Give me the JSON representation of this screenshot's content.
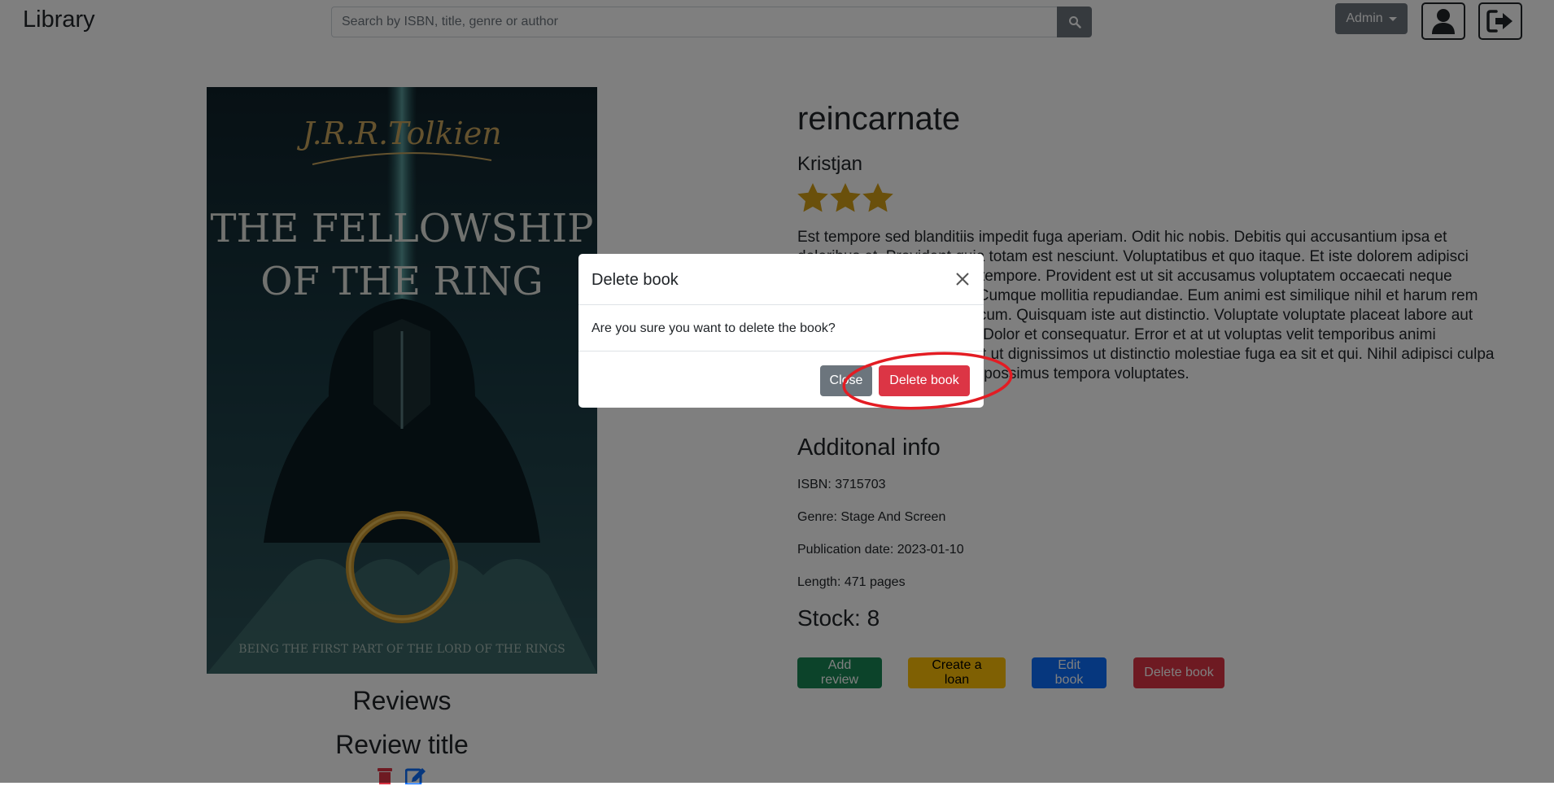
{
  "navbar": {
    "brand": "Library",
    "search_placeholder": "Search by ISBN, title, genre or author",
    "search_value": "",
    "admin_label": "Admin",
    "search_icon": "search-icon",
    "profile_icon": "user-icon",
    "logout_icon": "sign-out-icon"
  },
  "book": {
    "title": "reincarnate",
    "author": "Kristjan",
    "rating_stars": 3,
    "description": "Est tempore sed blanditiis impedit fuga aperiam. Odit hic nobis. Debitis qui accusantium ipsa et doloribus et. Provident quia totam est nesciunt. Voluptatibus et quo itaque. Et iste dolorem adipisci ullam voluptatem voluptas tempore. Provident est ut sit accusamus voluptatem occaecati neque voluptatem et aut nisi aut. Cumque mollitia repudiandae. Eum animi est similique nihil et harum rem velit blanditiis. Ut tempore cum. Quisquam iste aut distinctio. Voluptate voluptate placeat labore aut consectetur consequuntur. Dolor et consequatur. Error et at ut voluptas velit temporibus animi aperiam. Ipsam incidunt est ut dignissimos ut distinctio molestiae fuga ea sit et qui. Nihil adipisci culpa vitae consequatur quam ut possimus tempora voluptates.",
    "info_heading": "Additonal info",
    "isbn": "ISBN: 3715703",
    "genre": "Genre: Stage And Screen",
    "publication_date": "Publication date: 2023-01-10",
    "length": "Length: 471 pages",
    "stock": "Stock: 8"
  },
  "cover": {
    "author_script": "J.R.R.Tolkien",
    "title_line1": "THE FELLOWSHIP",
    "title_line2": "OF THE RING",
    "subtitle": "BEING THE FIRST PART OF THE LORD OF THE RINGS"
  },
  "actions": {
    "add_review": "Add review",
    "create_loan": "Create a loan",
    "edit_book": "Edit book",
    "delete_book": "Delete book"
  },
  "reviews": {
    "heading": "Reviews",
    "review_title": "Review title",
    "delete_icon": "trash-icon",
    "edit_icon": "edit-icon"
  },
  "modal": {
    "title": "Delete book",
    "body": "Are you sure you want to delete the book?",
    "close_label": "Close",
    "confirm_label": "Delete book",
    "close_icon": "close-icon"
  },
  "colors": {
    "secondary": "#6c757d",
    "success": "#198754",
    "warning": "#ffc107",
    "primary": "#0d6efd",
    "danger": "#dc3545",
    "star": "#d4a017",
    "annotation": "#e31c23"
  }
}
